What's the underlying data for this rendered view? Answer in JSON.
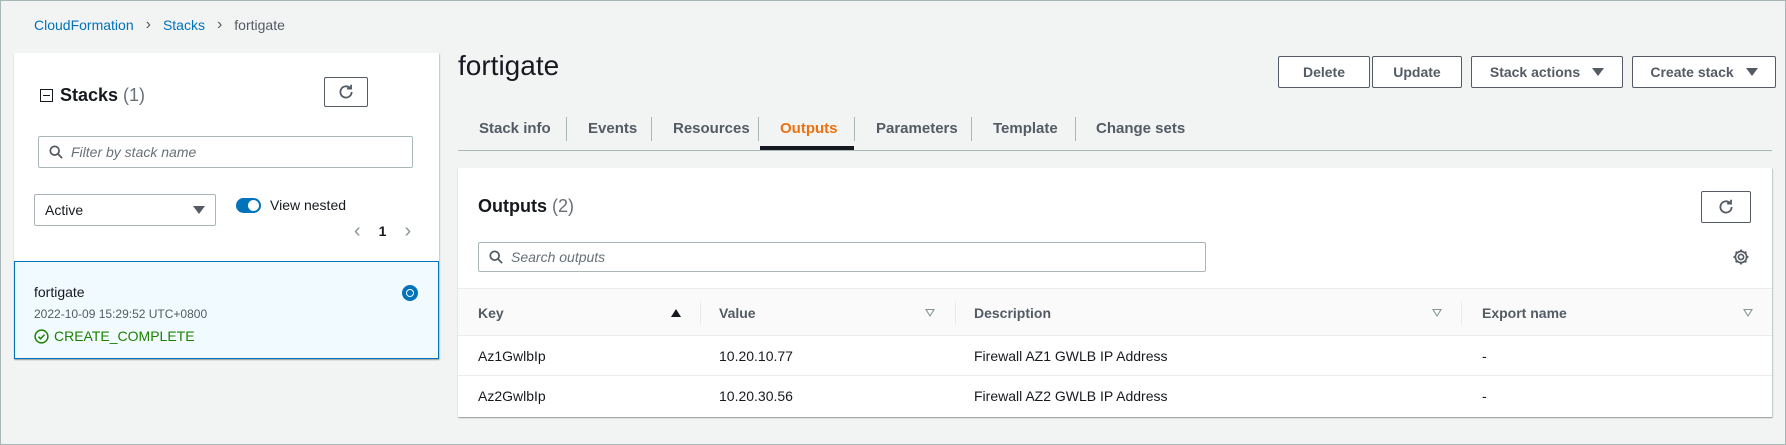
{
  "breadcrumb": {
    "items": [
      "CloudFormation",
      "Stacks",
      "fortigate"
    ]
  },
  "stacks_panel": {
    "title": "Stacks",
    "count": "(1)",
    "filter_placeholder": "Filter by stack name",
    "status_filter": "Active",
    "view_nested_label": "View nested",
    "view_nested_on": true,
    "page": "1",
    "stack": {
      "name": "fortigate",
      "timestamp": "2022-10-09 15:29:52 UTC+0800",
      "status": "CREATE_COMPLETE"
    }
  },
  "header": {
    "title": "fortigate",
    "buttons": {
      "delete": "Delete",
      "update": "Update",
      "stack_actions": "Stack actions",
      "create_stack": "Create stack"
    }
  },
  "tabs": [
    {
      "label": "Stack info",
      "active": false
    },
    {
      "label": "Events",
      "active": false
    },
    {
      "label": "Resources",
      "active": false
    },
    {
      "label": "Outputs",
      "active": true
    },
    {
      "label": "Parameters",
      "active": false
    },
    {
      "label": "Template",
      "active": false
    },
    {
      "label": "Change sets",
      "active": false
    }
  ],
  "outputs": {
    "title": "Outputs",
    "count": "(2)",
    "search_placeholder": "Search outputs",
    "columns": [
      "Key",
      "Value",
      "Description",
      "Export name"
    ],
    "rows": [
      {
        "key": "Az1GwlbIp",
        "value": "10.20.10.77",
        "description": "Firewall AZ1 GWLB IP Address",
        "export": "-"
      },
      {
        "key": "Az2GwlbIp",
        "value": "10.20.30.56",
        "description": "Firewall AZ2 GWLB IP Address",
        "export": "-"
      }
    ]
  },
  "colors": {
    "link": "#0073bb",
    "active_tab": "#ec7211",
    "success": "#1d8102"
  },
  "icons": [
    "refresh-icon",
    "search-icon",
    "settings-gear-icon",
    "success-check-icon",
    "chevron-right-icon",
    "chevron-left-icon",
    "caret-down-icon",
    "sort-ascending-icon"
  ]
}
